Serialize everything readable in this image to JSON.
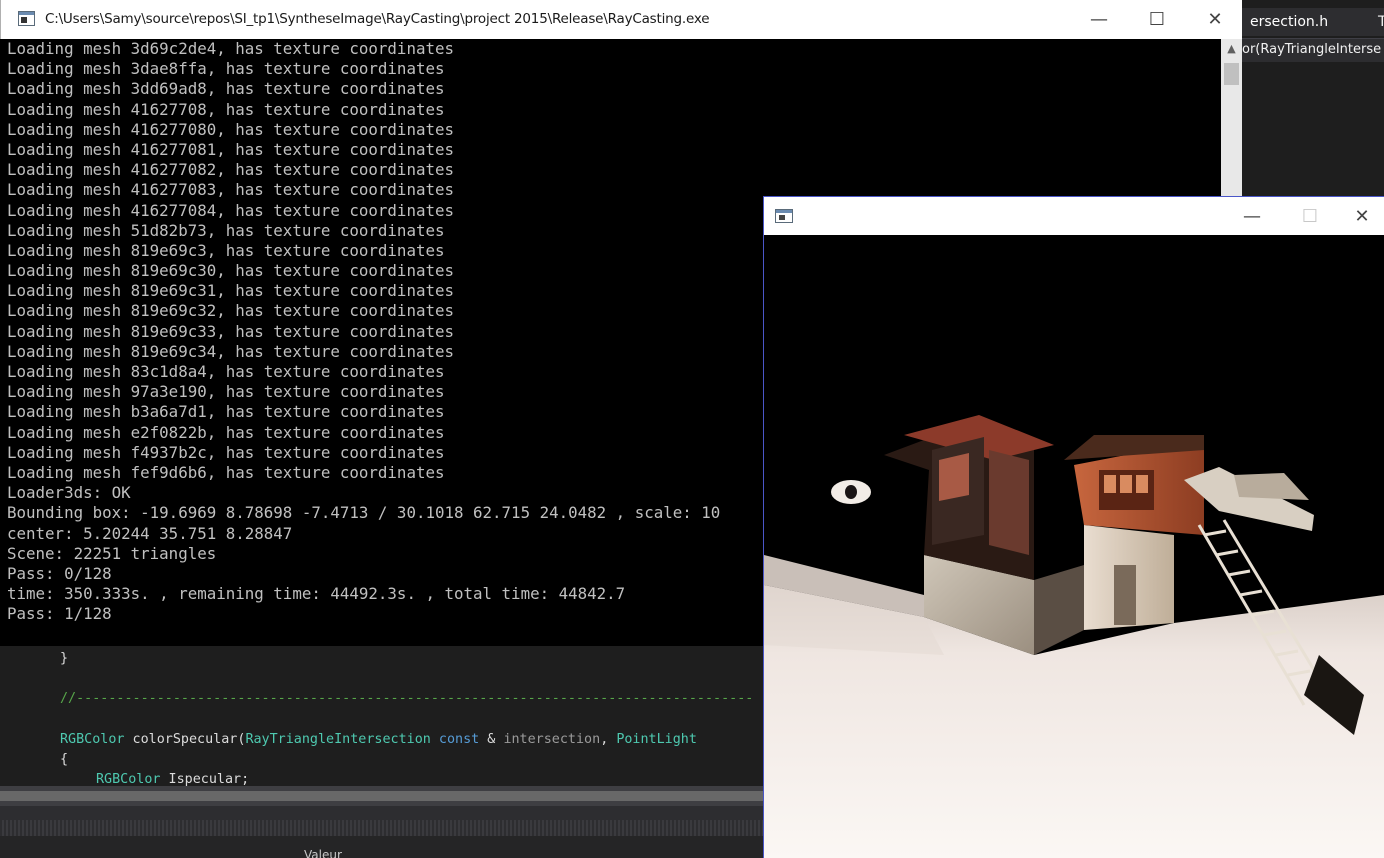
{
  "ide": {
    "tab_label": "ersection.h",
    "tab_extra": "T",
    "nav_dropdown_text": "or(RayTriangleInterse",
    "props_column_header": "Valeur",
    "code_lines": [
      {
        "text": "}",
        "kind": "plain"
      },
      {
        "text": "//------------------------------------------------------------------------------------",
        "kind": "comment"
      },
      {
        "type": "RGBColor",
        "fn": " colorSpecular(",
        "type2": "RayTriangleIntersection",
        "kw": " const",
        "amp": " & ",
        "param": "intersection",
        "sep": ", ",
        "type3": "PointLight"
      },
      {
        "text": "{",
        "kind": "plain"
      },
      {
        "type": "RGBColor",
        "rest": " Ispecular;"
      }
    ]
  },
  "console": {
    "title": "C:\\Users\\Samy\\source\\repos\\SI_tp1\\SyntheseImage\\RayCasting\\project 2015\\Release\\RayCasting.exe",
    "buttons": {
      "minimize": "—",
      "maximize": "☐",
      "close": "✕"
    },
    "lines": [
      "Loading mesh 3d69c2de4, has texture coordinates",
      "Loading mesh 3dae8ffa, has texture coordinates",
      "Loading mesh 3dd69ad8, has texture coordinates",
      "Loading mesh 41627708, has texture coordinates",
      "Loading mesh 416277080, has texture coordinates",
      "Loading mesh 416277081, has texture coordinates",
      "Loading mesh 416277082, has texture coordinates",
      "Loading mesh 416277083, has texture coordinates",
      "Loading mesh 416277084, has texture coordinates",
      "Loading mesh 51d82b73, has texture coordinates",
      "Loading mesh 819e69c3, has texture coordinates",
      "Loading mesh 819e69c30, has texture coordinates",
      "Loading mesh 819e69c31, has texture coordinates",
      "Loading mesh 819e69c32, has texture coordinates",
      "Loading mesh 819e69c33, has texture coordinates",
      "Loading mesh 819e69c34, has texture coordinates",
      "Loading mesh 83c1d8a4, has texture coordinates",
      "Loading mesh 97a3e190, has texture coordinates",
      "Loading mesh b3a6a7d1, has texture coordinates",
      "Loading mesh e2f0822b, has texture coordinates",
      "Loading mesh f4937b2c, has texture coordinates",
      "Loading mesh fef9d6b6, has texture coordinates",
      "Loader3ds: OK",
      "Bounding box: -19.6969 8.78698 -7.4713 / 30.1018 62.715 24.0482 , scale: 10",
      "center: 5.20244 35.751 8.28847",
      "Scene: 22251 triangles",
      "Pass: 0/128",
      "time: 350.333s. , remaining time: 44492.3s. , total time: 44842.7",
      "Pass: 1/128"
    ]
  },
  "render_window": {
    "buttons": {
      "minimize": "—",
      "maximize": "☐",
      "close": "✕"
    }
  },
  "colors": {
    "console_text": "#c0c0c0",
    "ide_background": "#1e1e1e",
    "render_border": "#4a56c8"
  }
}
